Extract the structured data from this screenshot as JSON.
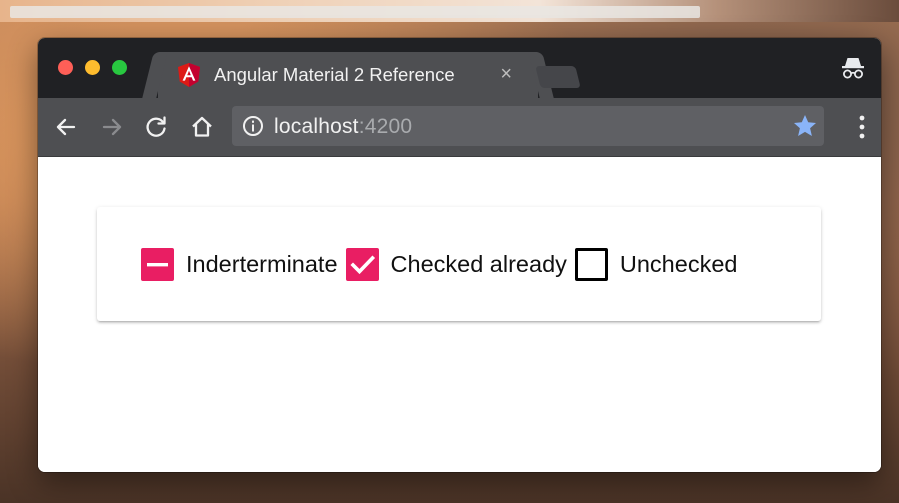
{
  "browser": {
    "tab": {
      "title": "Angular Material 2 Reference",
      "close_glyph": "×",
      "favicon": "angular-icon"
    },
    "address_bar": {
      "host": "localhost",
      "port": ":4200"
    },
    "icons": {
      "back": "arrow-left-icon",
      "forward": "arrow-right-icon",
      "reload": "reload-icon",
      "home": "home-icon",
      "info": "info-icon",
      "bookmark": "star-icon",
      "menu": "more-vertical-icon",
      "profile": "incognito-icon"
    }
  },
  "checkboxes": [
    {
      "label": "Inderterminate",
      "state": "indeterminate"
    },
    {
      "label": "Checked already",
      "state": "checked"
    },
    {
      "label": "Unchecked",
      "state": "unchecked"
    }
  ],
  "colors": {
    "accent": "#e91e63",
    "bookmark_star": "#8ab4f8",
    "traffic_red": "#fe5f57",
    "traffic_yellow": "#febc2e",
    "traffic_green": "#28c840"
  }
}
